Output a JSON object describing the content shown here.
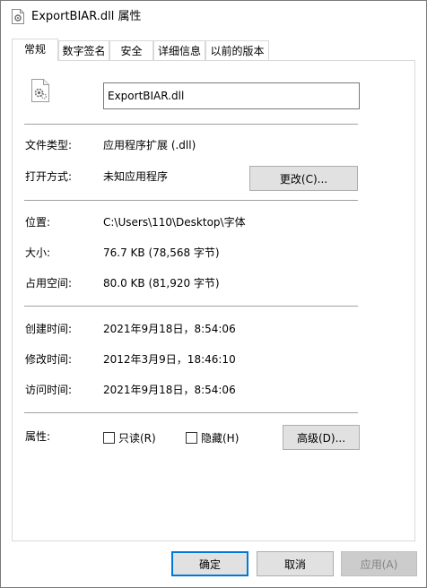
{
  "window": {
    "title": "ExportBIAR.dll 属性",
    "icon": "dll-gear-file-icon"
  },
  "tabs": [
    {
      "label": "常规",
      "active": true
    },
    {
      "label": "数字签名",
      "active": false
    },
    {
      "label": "安全",
      "active": false
    },
    {
      "label": "详细信息",
      "active": false
    },
    {
      "label": "以前的版本",
      "active": false
    }
  ],
  "general": {
    "file_icon": "dll-gear-file-icon",
    "file_name": "ExportBIAR.dll",
    "file_type_label": "文件类型:",
    "file_type_value": "应用程序扩展 (.dll)",
    "opens_with_label": "打开方式:",
    "opens_with_value": "未知应用程序",
    "change_button": "更改(C)...",
    "location_label": "位置:",
    "location_value": "C:\\Users\\110\\Desktop\\字体",
    "size_label": "大小:",
    "size_value": "76.7 KB (78,568 字节)",
    "size_on_disk_label": "占用空间:",
    "size_on_disk_value": "80.0 KB (81,920 字节)",
    "created_label": "创建时间:",
    "created_value": "2021年9月18日，8:54:06",
    "modified_label": "修改时间:",
    "modified_value": "2012年3月9日，18:46:10",
    "accessed_label": "访问时间:",
    "accessed_value": "2021年9月18日，8:54:06",
    "attributes_label": "属性:",
    "readonly_label": "只读(R)",
    "readonly_checked": false,
    "hidden_label": "隐藏(H)",
    "hidden_checked": false,
    "advanced_button": "高级(D)..."
  },
  "footer": {
    "ok_button": "确定",
    "cancel_button": "取消",
    "apply_button": "应用(A)"
  },
  "colors": {
    "default_button_border": "#0078d7",
    "button_face": "#e1e1e1",
    "separator": "#a0a0a0",
    "disabled_text": "#838383"
  }
}
